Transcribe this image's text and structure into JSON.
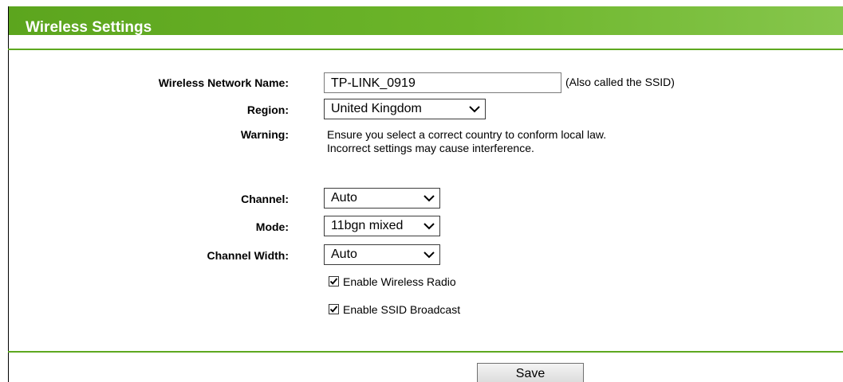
{
  "header": {
    "title": "Wireless Settings"
  },
  "form": {
    "ssid": {
      "label": "Wireless Network Name:",
      "value": "TP-LINK_0919",
      "hint": "(Also called the SSID)"
    },
    "region": {
      "label": "Region:",
      "value": "United Kingdom"
    },
    "warning": {
      "label": "Warning:",
      "line1": "Ensure you select a correct country to conform local law.",
      "line2": "Incorrect settings may cause interference."
    },
    "channel": {
      "label": "Channel:",
      "value": "Auto"
    },
    "mode": {
      "label": "Mode:",
      "value": "11bgn mixed"
    },
    "channel_width": {
      "label": "Channel Width:",
      "value": "Auto"
    },
    "enable_radio": {
      "label": "Enable Wireless Radio",
      "checked": true
    },
    "enable_ssid_broadcast": {
      "label": "Enable SSID Broadcast",
      "checked": true
    }
  },
  "actions": {
    "save_label": "Save"
  },
  "colors": {
    "header_green": "#6cb52a",
    "divider_green": "#5da81f"
  },
  "icons": {
    "dropdown": "chevron-down-icon",
    "check": "checkmark-icon"
  }
}
